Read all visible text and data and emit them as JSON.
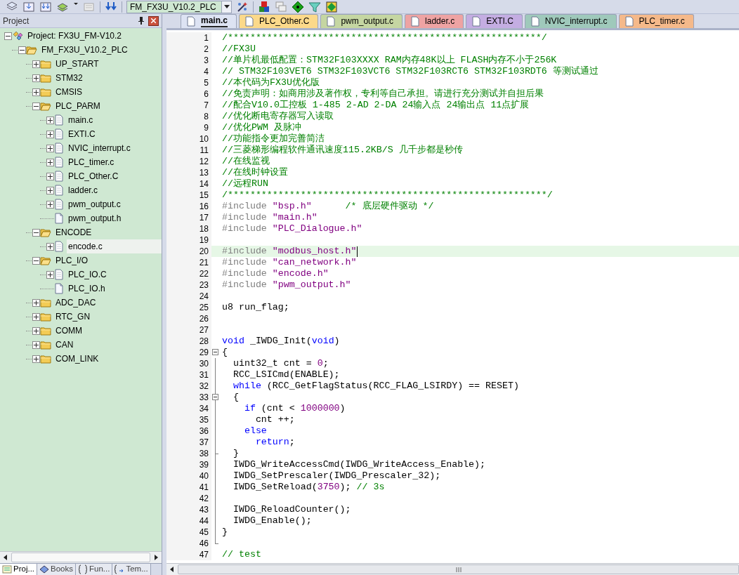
{
  "toolbar": {
    "target": "FM_FX3U_V10.2_PLC"
  },
  "project_panel": {
    "title": "Project",
    "tree": [
      {
        "label": "Project: FX3U_FM-V10.2",
        "kind": "project",
        "expanded": true,
        "selected": false,
        "children": [
          {
            "label": "FM_FX3U_V10.2_PLC",
            "kind": "target",
            "expanded": true,
            "selected": false,
            "children": [
              {
                "label": "UP_START",
                "kind": "folder",
                "expanded": false,
                "selected": false
              },
              {
                "label": "STM32",
                "kind": "folder",
                "expanded": false,
                "selected": false
              },
              {
                "label": "CMSIS",
                "kind": "folder",
                "expanded": false,
                "selected": false
              },
              {
                "label": "PLC_PARM",
                "kind": "folder",
                "expanded": true,
                "selected": false,
                "children": [
                  {
                    "label": "main.c",
                    "kind": "file",
                    "expanded": false,
                    "selected": false
                  },
                  {
                    "label": "EXTI.C",
                    "kind": "file",
                    "expanded": false,
                    "selected": false
                  },
                  {
                    "label": "NVIC_interrupt.c",
                    "kind": "file",
                    "expanded": false,
                    "selected": false
                  },
                  {
                    "label": "PLC_timer.c",
                    "kind": "file",
                    "expanded": false,
                    "selected": false
                  },
                  {
                    "label": "PLC_Other.C",
                    "kind": "file",
                    "expanded": false,
                    "selected": false
                  },
                  {
                    "label": "ladder.c",
                    "kind": "file",
                    "expanded": false,
                    "selected": false
                  },
                  {
                    "label": "pwm_output.c",
                    "kind": "file",
                    "expanded": false,
                    "selected": false
                  },
                  {
                    "label": "pwm_output.h",
                    "kind": "header",
                    "selected": false
                  }
                ]
              },
              {
                "label": "ENCODE",
                "kind": "folder",
                "expanded": true,
                "selected": false,
                "children": [
                  {
                    "label": "encode.c",
                    "kind": "file",
                    "expanded": false,
                    "selected": true
                  }
                ]
              },
              {
                "label": "PLC_I/O",
                "kind": "folder",
                "expanded": true,
                "selected": false,
                "children": [
                  {
                    "label": "PLC_IO.C",
                    "kind": "file",
                    "expanded": false,
                    "selected": false
                  },
                  {
                    "label": "PLC_IO.h",
                    "kind": "header",
                    "selected": false
                  }
                ]
              },
              {
                "label": "ADC_DAC",
                "kind": "folder",
                "expanded": false,
                "selected": false
              },
              {
                "label": "RTC_GN",
                "kind": "folder",
                "expanded": false,
                "selected": false
              },
              {
                "label": "COMM",
                "kind": "folder",
                "expanded": false,
                "selected": false
              },
              {
                "label": "CAN",
                "kind": "folder",
                "expanded": false,
                "selected": false
              },
              {
                "label": "COM_LINK",
                "kind": "folder",
                "expanded": false,
                "selected": false
              }
            ]
          }
        ]
      }
    ],
    "bottom_tabs": [
      {
        "label": "Proj...",
        "kind": "project",
        "selected": true
      },
      {
        "label": "Books",
        "kind": "books",
        "selected": false
      },
      {
        "label": "Fun...",
        "kind": "functions",
        "selected": false
      },
      {
        "label": "Tem...",
        "kind": "templates",
        "selected": false
      }
    ]
  },
  "editor": {
    "tabs": [
      {
        "label": "main.c",
        "color": "#dde3f3",
        "selected": true
      },
      {
        "label": "PLC_Other.C",
        "color": "#fcd98a",
        "selected": false
      },
      {
        "label": "pwm_output.c",
        "color": "#c5d6a2",
        "selected": false
      },
      {
        "label": "ladder.c",
        "color": "#eea3a3",
        "selected": false
      },
      {
        "label": "EXTI.C",
        "color": "#c4ade2",
        "selected": false
      },
      {
        "label": "NVIC_interrupt.c",
        "color": "#9fc9bb",
        "selected": false
      },
      {
        "label": "PLC_timer.c",
        "color": "#f5b98a",
        "selected": false
      }
    ],
    "lines": [
      {
        "number": "1",
        "kind": "text",
        "segments": [
          {
            "kind": "comment",
            "text": "/********************************************************/"
          }
        ]
      },
      {
        "number": "2",
        "kind": "text",
        "segments": [
          {
            "kind": "comment",
            "text": "//FX3U"
          }
        ]
      },
      {
        "number": "3",
        "kind": "text",
        "segments": [
          {
            "kind": "comment",
            "text": "//单片机最低配置：STM32F103XXXX RAM内存48K以上 FLASH内存不小于256K"
          }
        ]
      },
      {
        "number": "4",
        "kind": "text",
        "segments": [
          {
            "kind": "comment",
            "text": "// STM32F103VET6 STM32F103VCT6 STM32F103RCT6 STM32F103RDT6 等测试通过"
          }
        ]
      },
      {
        "number": "5",
        "kind": "text",
        "segments": [
          {
            "kind": "comment",
            "text": "//本代码为FX3U优化版"
          }
        ]
      },
      {
        "number": "6",
        "kind": "text",
        "segments": [
          {
            "kind": "comment",
            "text": "//免责声明：如商用涉及著作权，专利等自己承担。请进行充分测试并自担后果"
          }
        ]
      },
      {
        "number": "7",
        "kind": "text",
        "segments": [
          {
            "kind": "comment",
            "text": "//配合V10.0工控板 1-485 2-AD 2-DA 24输入点 24输出点 11点扩展"
          }
        ]
      },
      {
        "number": "8",
        "kind": "text",
        "segments": [
          {
            "kind": "comment",
            "text": "//优化断电寄存器写入读取"
          }
        ]
      },
      {
        "number": "9",
        "kind": "text",
        "segments": [
          {
            "kind": "comment",
            "text": "//优化PWM 及脉冲"
          }
        ]
      },
      {
        "number": "10",
        "kind": "text",
        "segments": [
          {
            "kind": "comment",
            "text": "//功能指令更加完善简洁"
          }
        ]
      },
      {
        "number": "11",
        "kind": "text",
        "segments": [
          {
            "kind": "comment",
            "text": "//三菱梯形编程软件通讯速度115.2KB/S 几千步都是秒传"
          }
        ]
      },
      {
        "number": "12",
        "kind": "text",
        "segments": [
          {
            "kind": "comment",
            "text": "//在线监视"
          }
        ]
      },
      {
        "number": "13",
        "kind": "text",
        "segments": [
          {
            "kind": "comment",
            "text": "//在线时钟设置"
          }
        ]
      },
      {
        "number": "14",
        "kind": "text",
        "segments": [
          {
            "kind": "comment",
            "text": "//远程RUN"
          }
        ]
      },
      {
        "number": "15",
        "kind": "text",
        "segments": [
          {
            "kind": "comment",
            "text": "/*********************************************************/"
          }
        ]
      },
      {
        "number": "16",
        "kind": "text",
        "segments": [
          {
            "kind": "preproc",
            "text": "#include "
          },
          {
            "kind": "string",
            "text": "\"bsp.h\""
          },
          {
            "kind": "comment",
            "text": "      /* 底层硬件驱动 */"
          }
        ]
      },
      {
        "number": "17",
        "kind": "text",
        "segments": [
          {
            "kind": "preproc",
            "text": "#include "
          },
          {
            "kind": "string",
            "text": "\"main.h\""
          }
        ]
      },
      {
        "number": "18",
        "kind": "text",
        "segments": [
          {
            "kind": "preproc",
            "text": "#include "
          },
          {
            "kind": "string",
            "text": "\"PLC_Dialogue.h\""
          }
        ]
      },
      {
        "number": "19",
        "kind": "text"
      },
      {
        "number": "20",
        "kind": "current",
        "segments": [
          {
            "kind": "preproc",
            "text": "#include "
          },
          {
            "kind": "string",
            "text": "\"modbus_host.h\""
          }
        ]
      },
      {
        "number": "21",
        "kind": "text",
        "segments": [
          {
            "kind": "preproc",
            "text": "#include "
          },
          {
            "kind": "string",
            "text": "\"can_network.h\""
          }
        ]
      },
      {
        "number": "22",
        "kind": "text",
        "segments": [
          {
            "kind": "preproc",
            "text": "#include "
          },
          {
            "kind": "string",
            "text": "\"encode.h\""
          }
        ]
      },
      {
        "number": "23",
        "kind": "text",
        "segments": [
          {
            "kind": "preproc",
            "text": "#include "
          },
          {
            "kind": "string",
            "text": "\"pwm_output.h\""
          }
        ]
      },
      {
        "number": "24",
        "kind": "text"
      },
      {
        "number": "25",
        "kind": "text",
        "segments": [
          {
            "kind": "plain",
            "text": "u8 run_flag;"
          }
        ]
      },
      {
        "number": "26",
        "kind": "text"
      },
      {
        "number": "27",
        "kind": "text"
      },
      {
        "number": "28",
        "kind": "text",
        "segments": [
          {
            "kind": "keyword",
            "text": "void"
          },
          {
            "kind": "plain",
            "text": " _IWDG_Init("
          },
          {
            "kind": "keyword",
            "text": "void"
          },
          {
            "kind": "plain",
            "text": ")"
          }
        ]
      },
      {
        "number": "29",
        "kind": "fold_start",
        "segments": [
          {
            "kind": "plain",
            "text": "{"
          }
        ]
      },
      {
        "number": "30",
        "kind": "text",
        "segments": [
          {
            "kind": "plain",
            "text": "  uint32_t cnt = "
          },
          {
            "kind": "number",
            "text": "0"
          },
          {
            "kind": "plain",
            "text": ";"
          }
        ]
      },
      {
        "number": "31",
        "kind": "text",
        "segments": [
          {
            "kind": "plain",
            "text": "  RCC_LSICmd(ENABLE);"
          }
        ]
      },
      {
        "number": "32",
        "kind": "text",
        "segments": [
          {
            "kind": "keyword",
            "text": "  while"
          },
          {
            "kind": "plain",
            "text": " (RCC_GetFlagStatus(RCC_FLAG_LSIRDY) == RESET)"
          }
        ]
      },
      {
        "number": "33",
        "kind": "fold_start",
        "segments": [
          {
            "kind": "plain",
            "text": "  {"
          }
        ]
      },
      {
        "number": "34",
        "kind": "text",
        "segments": [
          {
            "kind": "keyword",
            "text": "    if"
          },
          {
            "kind": "plain",
            "text": " (cnt < "
          },
          {
            "kind": "number",
            "text": "1000000"
          },
          {
            "kind": "plain",
            "text": ")"
          }
        ]
      },
      {
        "number": "35",
        "kind": "text",
        "segments": [
          {
            "kind": "plain",
            "text": "      cnt ++;"
          }
        ]
      },
      {
        "number": "36",
        "kind": "text",
        "segments": [
          {
            "kind": "keyword",
            "text": "    else"
          }
        ]
      },
      {
        "number": "37",
        "kind": "text",
        "segments": [
          {
            "kind": "keyword",
            "text": "      return"
          },
          {
            "kind": "plain",
            "text": ";"
          }
        ]
      },
      {
        "number": "38",
        "kind": "fold_end",
        "segments": [
          {
            "kind": "plain",
            "text": "  }"
          }
        ]
      },
      {
        "number": "39",
        "kind": "text",
        "segments": [
          {
            "kind": "plain",
            "text": "  IWDG_WriteAccessCmd(IWDG_WriteAccess_Enable);"
          }
        ]
      },
      {
        "number": "40",
        "kind": "text",
        "segments": [
          {
            "kind": "plain",
            "text": "  IWDG_SetPrescaler(IWDG_Prescaler_32);"
          }
        ]
      },
      {
        "number": "41",
        "kind": "text",
        "segments": [
          {
            "kind": "plain",
            "text": "  IWDG_SetReload("
          },
          {
            "kind": "number",
            "text": "3750"
          },
          {
            "kind": "plain",
            "text": "); "
          },
          {
            "kind": "comment",
            "text": "// 3s"
          }
        ]
      },
      {
        "number": "42",
        "kind": "text"
      },
      {
        "number": "43",
        "kind": "text",
        "segments": [
          {
            "kind": "plain",
            "text": "  IWDG_ReloadCounter();"
          }
        ]
      },
      {
        "number": "44",
        "kind": "text",
        "segments": [
          {
            "kind": "plain",
            "text": "  IWDG_Enable();"
          }
        ]
      },
      {
        "number": "45",
        "kind": "text",
        "segments": [
          {
            "kind": "plain",
            "text": "}"
          }
        ]
      },
      {
        "number": "46",
        "kind": "fold_end"
      },
      {
        "number": "47",
        "kind": "text",
        "segments": [
          {
            "kind": "comment",
            "text": "// test"
          }
        ]
      }
    ]
  }
}
